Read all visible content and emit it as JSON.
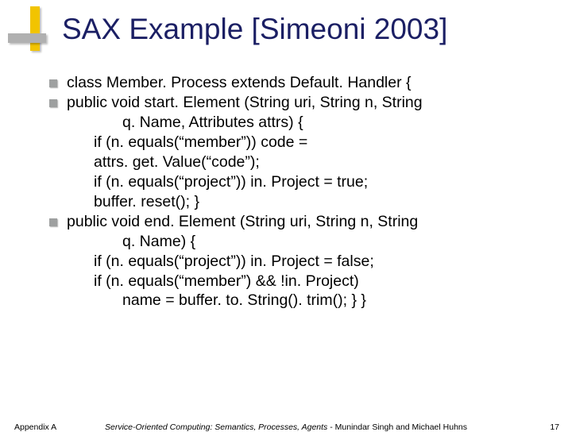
{
  "title": "SAX Example [Simeoni 2003]",
  "code": {
    "l1": "class Member. Process extends Default. Handler {",
    "l2": "public void start. Element (String uri, String n, String",
    "l3": "q. Name, Attributes attrs) {",
    "l4a": "if (n. equals(“member”)) code =",
    "l4b": "attrs. get. Value(“code”);",
    "l5": "if (n. equals(“project”)) in. Project = true;",
    "l6": "buffer. reset(); }",
    "l7": "public void end. Element (String uri, String n, String",
    "l8": "q. Name) {",
    "l9": "if (n. equals(“project”)) in. Project = false;",
    "l10": "if (n. equals(“member”) && !in. Project)",
    "l11": "name = buffer. to. String(). trim(); } }"
  },
  "footer": {
    "left": "Appendix A",
    "center_italic": "Service-Oriented Computing: Semantics, Processes, Agents",
    "center_rest": " - Munindar Singh and Michael Huhns",
    "page": "17"
  }
}
